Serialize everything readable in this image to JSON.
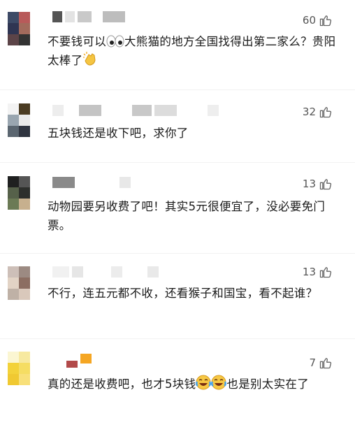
{
  "comments": [
    {
      "likes": "60",
      "text_a": "不要钱可以",
      "text_b": "大熊猫的地方全国找得出第二家么？贵阳太棒了"
    },
    {
      "likes": "32",
      "text": "五块钱还是收下吧，求你了"
    },
    {
      "likes": "13",
      "text": "动物园要另收费了吧！其实5元很便宜了，没必要免门票。"
    },
    {
      "likes": "13",
      "text": "不行，连五元都不收，还看猴子和国宝，看不起谁？"
    },
    {
      "likes": "7",
      "text_a": "真的还是收费吧，也才5块钱",
      "text_b": "也是别太实在了"
    }
  ],
  "icons": {
    "like": "thumbs-up-icon",
    "eyes": "eyes-emoji-icon",
    "clap": "clapping-hands-emoji-icon",
    "laugh": "tears-of-joy-emoji-icon"
  }
}
